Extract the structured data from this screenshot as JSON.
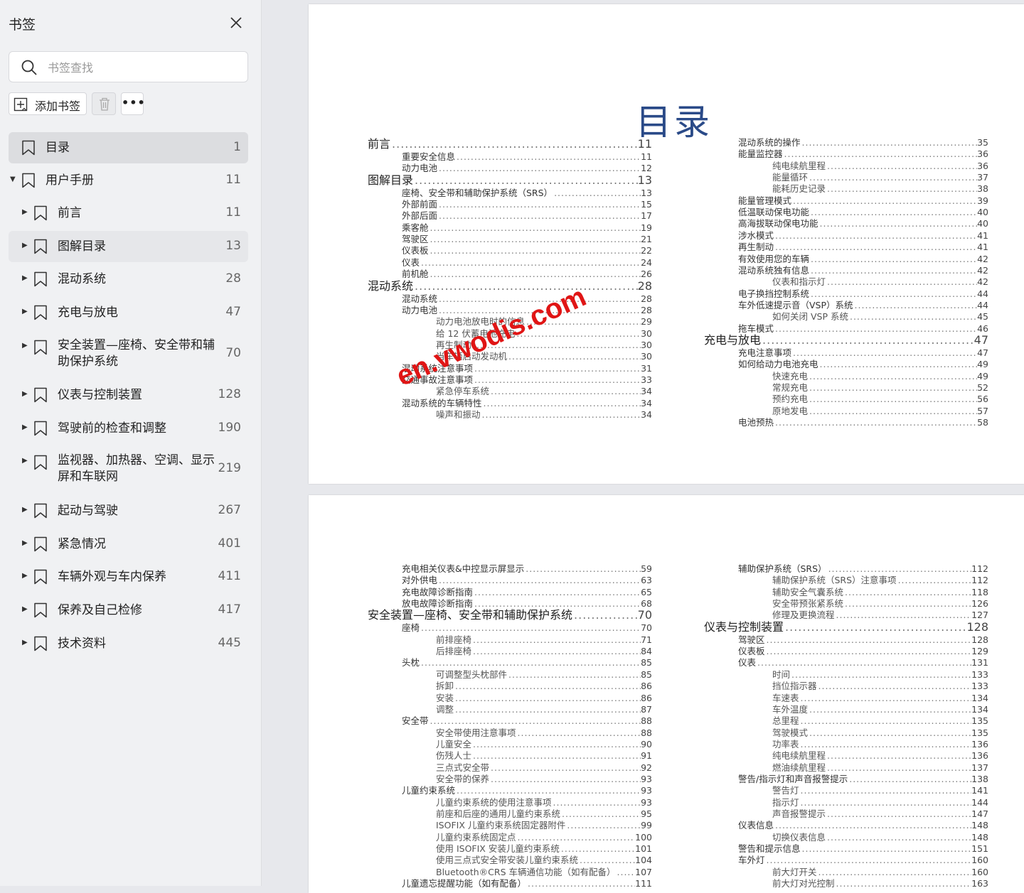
{
  "sidebar": {
    "title": "书签",
    "search_placeholder": "书签查找",
    "add_label": "添加书签",
    "items": [
      {
        "label": "目录",
        "page": "1",
        "arrow": "",
        "indent": 0,
        "state": "selected"
      },
      {
        "label": "用户手册",
        "page": "11",
        "arrow": "▼",
        "indent": 0,
        "state": ""
      },
      {
        "label": "前言",
        "page": "11",
        "arrow": "▶",
        "indent": 1,
        "state": ""
      },
      {
        "label": "图解目录",
        "page": "13",
        "arrow": "▶",
        "indent": 1,
        "state": "hover"
      },
      {
        "label": "混动系统",
        "page": "28",
        "arrow": "▶",
        "indent": 1,
        "state": ""
      },
      {
        "label": "充电与放电",
        "page": "47",
        "arrow": "▶",
        "indent": 1,
        "state": ""
      },
      {
        "label": "安全装置—座椅、安全带和辅助保护系统",
        "page": "70",
        "arrow": "▶",
        "indent": 1,
        "state": ""
      },
      {
        "label": "仪表与控制装置",
        "page": "128",
        "arrow": "▶",
        "indent": 1,
        "state": ""
      },
      {
        "label": "驾驶前的检查和调整",
        "page": "190",
        "arrow": "▶",
        "indent": 1,
        "state": ""
      },
      {
        "label": "监视器、加热器、空调、显示屏和车联网",
        "page": "219",
        "arrow": "▶",
        "indent": 1,
        "state": ""
      },
      {
        "label": "起动与驾驶",
        "page": "267",
        "arrow": "▶",
        "indent": 1,
        "state": ""
      },
      {
        "label": "紧急情况",
        "page": "401",
        "arrow": "▶",
        "indent": 1,
        "state": ""
      },
      {
        "label": "车辆外观与车内保养",
        "page": "411",
        "arrow": "▶",
        "indent": 1,
        "state": ""
      },
      {
        "label": "保养及自己检修",
        "page": "417",
        "arrow": "▶",
        "indent": 1,
        "state": ""
      },
      {
        "label": "技术资料",
        "page": "445",
        "arrow": "▶",
        "indent": 1,
        "state": ""
      }
    ]
  },
  "document": {
    "title": "目录",
    "watermark": "en.vwodis.com",
    "page1_left": [
      {
        "t": "前言",
        "p": "11",
        "l": 1
      },
      {
        "t": "重要安全信息",
        "p": "11",
        "l": 2
      },
      {
        "t": "动力电池",
        "p": "12",
        "l": 2
      },
      {
        "t": "图解目录",
        "p": "13",
        "l": 1
      },
      {
        "t": "座椅、安全带和辅助保护系统（SRS）",
        "p": "13",
        "l": 2
      },
      {
        "t": "外部前面",
        "p": "15",
        "l": 2
      },
      {
        "t": "外部后面",
        "p": "17",
        "l": 2
      },
      {
        "t": "乘客舱",
        "p": "19",
        "l": 2
      },
      {
        "t": "驾驶区",
        "p": "21",
        "l": 2
      },
      {
        "t": "仪表板",
        "p": "22",
        "l": 2
      },
      {
        "t": "仪表",
        "p": "24",
        "l": 2
      },
      {
        "t": "前机舱",
        "p": "26",
        "l": 2
      },
      {
        "t": "混动系统",
        "p": "28",
        "l": 1
      },
      {
        "t": "混动系统",
        "p": "28",
        "l": 2
      },
      {
        "t": "动力电池",
        "p": "28",
        "l": 2
      },
      {
        "t": "动力电池放电时的信息",
        "p": "29",
        "l": 3
      },
      {
        "t": "给 12 伏蓄电池充电",
        "p": "30",
        "l": 3
      },
      {
        "t": "再生制动",
        "p": "30",
        "l": 3
      },
      {
        "t": "当车辆启动发动机",
        "p": "30",
        "l": 3
      },
      {
        "t": "混动系统注意事项",
        "p": "31",
        "l": 2
      },
      {
        "t": "交通事故注意事项",
        "p": "33",
        "l": 2
      },
      {
        "t": "紧急停车系统",
        "p": "34",
        "l": 3
      },
      {
        "t": "混动系统的车辆特性",
        "p": "34",
        "l": 2
      },
      {
        "t": "噪声和振动",
        "p": "34",
        "l": 3
      }
    ],
    "page1_right": [
      {
        "t": "混动系统的操作",
        "p": "35",
        "l": 2
      },
      {
        "t": "能量监控器",
        "p": "36",
        "l": 2
      },
      {
        "t": "纯电续航里程",
        "p": "36",
        "l": 3
      },
      {
        "t": "能量循环",
        "p": "37",
        "l": 3
      },
      {
        "t": "能耗历史记录",
        "p": "38",
        "l": 3
      },
      {
        "t": "能量管理模式",
        "p": "39",
        "l": 2
      },
      {
        "t": "低温联动保电功能",
        "p": "40",
        "l": 2
      },
      {
        "t": "高海拔联动保电功能",
        "p": "40",
        "l": 2
      },
      {
        "t": "涉水模式",
        "p": "41",
        "l": 2
      },
      {
        "t": "再生制动",
        "p": "41",
        "l": 2
      },
      {
        "t": "有效使用您的车辆",
        "p": "42",
        "l": 2
      },
      {
        "t": "混动系统独有信息",
        "p": "42",
        "l": 2
      },
      {
        "t": "仪表和指示灯",
        "p": "42",
        "l": 3
      },
      {
        "t": "电子换挡控制系统",
        "p": "44",
        "l": 2
      },
      {
        "t": "车外低速提示音（VSP）系统",
        "p": "44",
        "l": 2
      },
      {
        "t": "如何关闭 VSP 系统",
        "p": "45",
        "l": 3
      },
      {
        "t": "拖车模式",
        "p": "46",
        "l": 2
      },
      {
        "t": "充电与放电",
        "p": "47",
        "l": 1
      },
      {
        "t": "充电注意事项",
        "p": "47",
        "l": 2
      },
      {
        "t": "如何给动力电池充电",
        "p": "49",
        "l": 2
      },
      {
        "t": "快速充电",
        "p": "49",
        "l": 3
      },
      {
        "t": "常规充电",
        "p": "52",
        "l": 3
      },
      {
        "t": "预约充电",
        "p": "56",
        "l": 3
      },
      {
        "t": "原地发电",
        "p": "57",
        "l": 3
      },
      {
        "t": "电池预热",
        "p": "58",
        "l": 2
      }
    ],
    "page2_left": [
      {
        "t": "充电相关仪表&中控显示屏显示",
        "p": "59",
        "l": 2
      },
      {
        "t": "对外供电",
        "p": "63",
        "l": 2
      },
      {
        "t": "充电故障诊断指南",
        "p": "65",
        "l": 2
      },
      {
        "t": "放电故障诊断指南",
        "p": "68",
        "l": 2
      },
      {
        "t": "安全装置—座椅、安全带和辅助保护系统",
        "p": "70",
        "l": 1
      },
      {
        "t": "座椅",
        "p": "70",
        "l": 2
      },
      {
        "t": "前排座椅",
        "p": "71",
        "l": 3
      },
      {
        "t": "后排座椅",
        "p": "84",
        "l": 3
      },
      {
        "t": "头枕",
        "p": "85",
        "l": 2
      },
      {
        "t": "可调整型头枕部件",
        "p": "85",
        "l": 3
      },
      {
        "t": "拆卸",
        "p": "86",
        "l": 3
      },
      {
        "t": "安装",
        "p": "86",
        "l": 3
      },
      {
        "t": "调整",
        "p": "87",
        "l": 3
      },
      {
        "t": "安全带",
        "p": "88",
        "l": 2
      },
      {
        "t": "安全带使用注意事项",
        "p": "88",
        "l": 3
      },
      {
        "t": "儿童安全",
        "p": "90",
        "l": 3
      },
      {
        "t": "伤残人士",
        "p": "91",
        "l": 3
      },
      {
        "t": "三点式安全带",
        "p": "92",
        "l": 3
      },
      {
        "t": "安全带的保养",
        "p": "93",
        "l": 3
      },
      {
        "t": "儿童约束系统",
        "p": "93",
        "l": 2
      },
      {
        "t": "儿童约束系统的使用注意事项",
        "p": "93",
        "l": 3
      },
      {
        "t": "前座和后座的通用儿童约束系统",
        "p": "95",
        "l": 3
      },
      {
        "t": "ISOFIX 儿童约束系统固定器附件",
        "p": "99",
        "l": 3
      },
      {
        "t": "儿童约束系统固定点",
        "p": "100",
        "l": 3
      },
      {
        "t": "使用 ISOFIX 安装儿童约束系统",
        "p": "101",
        "l": 3
      },
      {
        "t": "使用三点式安全带安装儿童约束系统",
        "p": "104",
        "l": 3
      },
      {
        "t": "Bluetooth®CRS 车辆通信功能（如有配备）",
        "p": "107",
        "l": 3
      },
      {
        "t": "儿童遗忘提醒功能（如有配备）",
        "p": "111",
        "l": 2
      }
    ],
    "page2_right": [
      {
        "t": "辅助保护系统（SRS）",
        "p": "112",
        "l": 2
      },
      {
        "t": "辅助保护系统（SRS）注意事项",
        "p": "112",
        "l": 3
      },
      {
        "t": "辅助安全气囊系统",
        "p": "118",
        "l": 3
      },
      {
        "t": "安全带预张紧系统",
        "p": "126",
        "l": 3
      },
      {
        "t": "修理及更换流程",
        "p": "127",
        "l": 3
      },
      {
        "t": "仪表与控制装置",
        "p": "128",
        "l": 1
      },
      {
        "t": "驾驶区",
        "p": "128",
        "l": 2
      },
      {
        "t": "仪表板",
        "p": "129",
        "l": 2
      },
      {
        "t": "仪表",
        "p": "131",
        "l": 2
      },
      {
        "t": "时间",
        "p": "133",
        "l": 3
      },
      {
        "t": "挡位指示器",
        "p": "133",
        "l": 3
      },
      {
        "t": "车速表",
        "p": "134",
        "l": 3
      },
      {
        "t": "车外温度",
        "p": "134",
        "l": 3
      },
      {
        "t": "总里程",
        "p": "135",
        "l": 3
      },
      {
        "t": "驾驶模式",
        "p": "135",
        "l": 3
      },
      {
        "t": "功率表",
        "p": "136",
        "l": 3
      },
      {
        "t": "纯电续航里程",
        "p": "136",
        "l": 3
      },
      {
        "t": "燃油续航里程",
        "p": "137",
        "l": 3
      },
      {
        "t": "警告/指示灯和声音报警提示",
        "p": "138",
        "l": 2
      },
      {
        "t": "警告灯",
        "p": "141",
        "l": 3
      },
      {
        "t": "指示灯",
        "p": "144",
        "l": 3
      },
      {
        "t": "声音报警提示",
        "p": "147",
        "l": 3
      },
      {
        "t": "仪表信息",
        "p": "148",
        "l": 2
      },
      {
        "t": "切换仪表信息",
        "p": "148",
        "l": 3
      },
      {
        "t": "警告和提示信息",
        "p": "151",
        "l": 2
      },
      {
        "t": "车外灯",
        "p": "160",
        "l": 2
      },
      {
        "t": "前大灯开关",
        "p": "160",
        "l": 3
      },
      {
        "t": "前大灯对光控制",
        "p": "163",
        "l": 3
      }
    ]
  }
}
